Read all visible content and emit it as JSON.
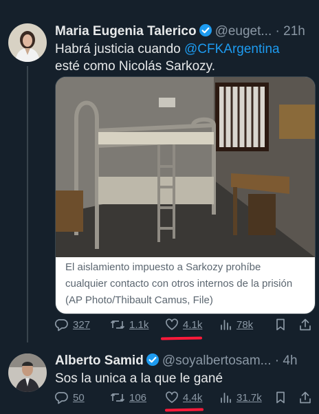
{
  "tweet1": {
    "author_name": "Maria Eugenia Talerico",
    "handle": "@euget...",
    "separator": " · ",
    "time": "21h",
    "text_before": "Habrá justicia cuando ",
    "mention": "@CFKArgentina",
    "text_after": " esté como Nicolás Sarkozy.",
    "media": {
      "description": "Prison cell with bunk bed",
      "caption": "El aislamiento impuesto a Sarkozy prohíbe cualquier contacto con otros internos de la prisión (AP Photo/Thibault Camus, File)"
    },
    "actions": {
      "replies": "327",
      "reposts": "1.1k",
      "likes": "4.1k",
      "views": "78k"
    }
  },
  "tweet2": {
    "author_name": "Alberto Samid",
    "handle": "@soyalbertosam...",
    "separator": " · ",
    "time": "4h",
    "text": "Sos la unica a la que le gané",
    "actions": {
      "replies": "50",
      "reposts": "106",
      "likes": "4.4k",
      "views": "31.7k"
    }
  },
  "colors": {
    "background": "#15202b",
    "verified": "#1d9bf0",
    "mention": "#1d9bf0",
    "annotation_underline": "#ff1a3a"
  },
  "icons": [
    "reply-icon",
    "repost-icon",
    "like-icon",
    "views-icon",
    "bookmark-icon",
    "share-icon",
    "verified-badge-icon"
  ]
}
